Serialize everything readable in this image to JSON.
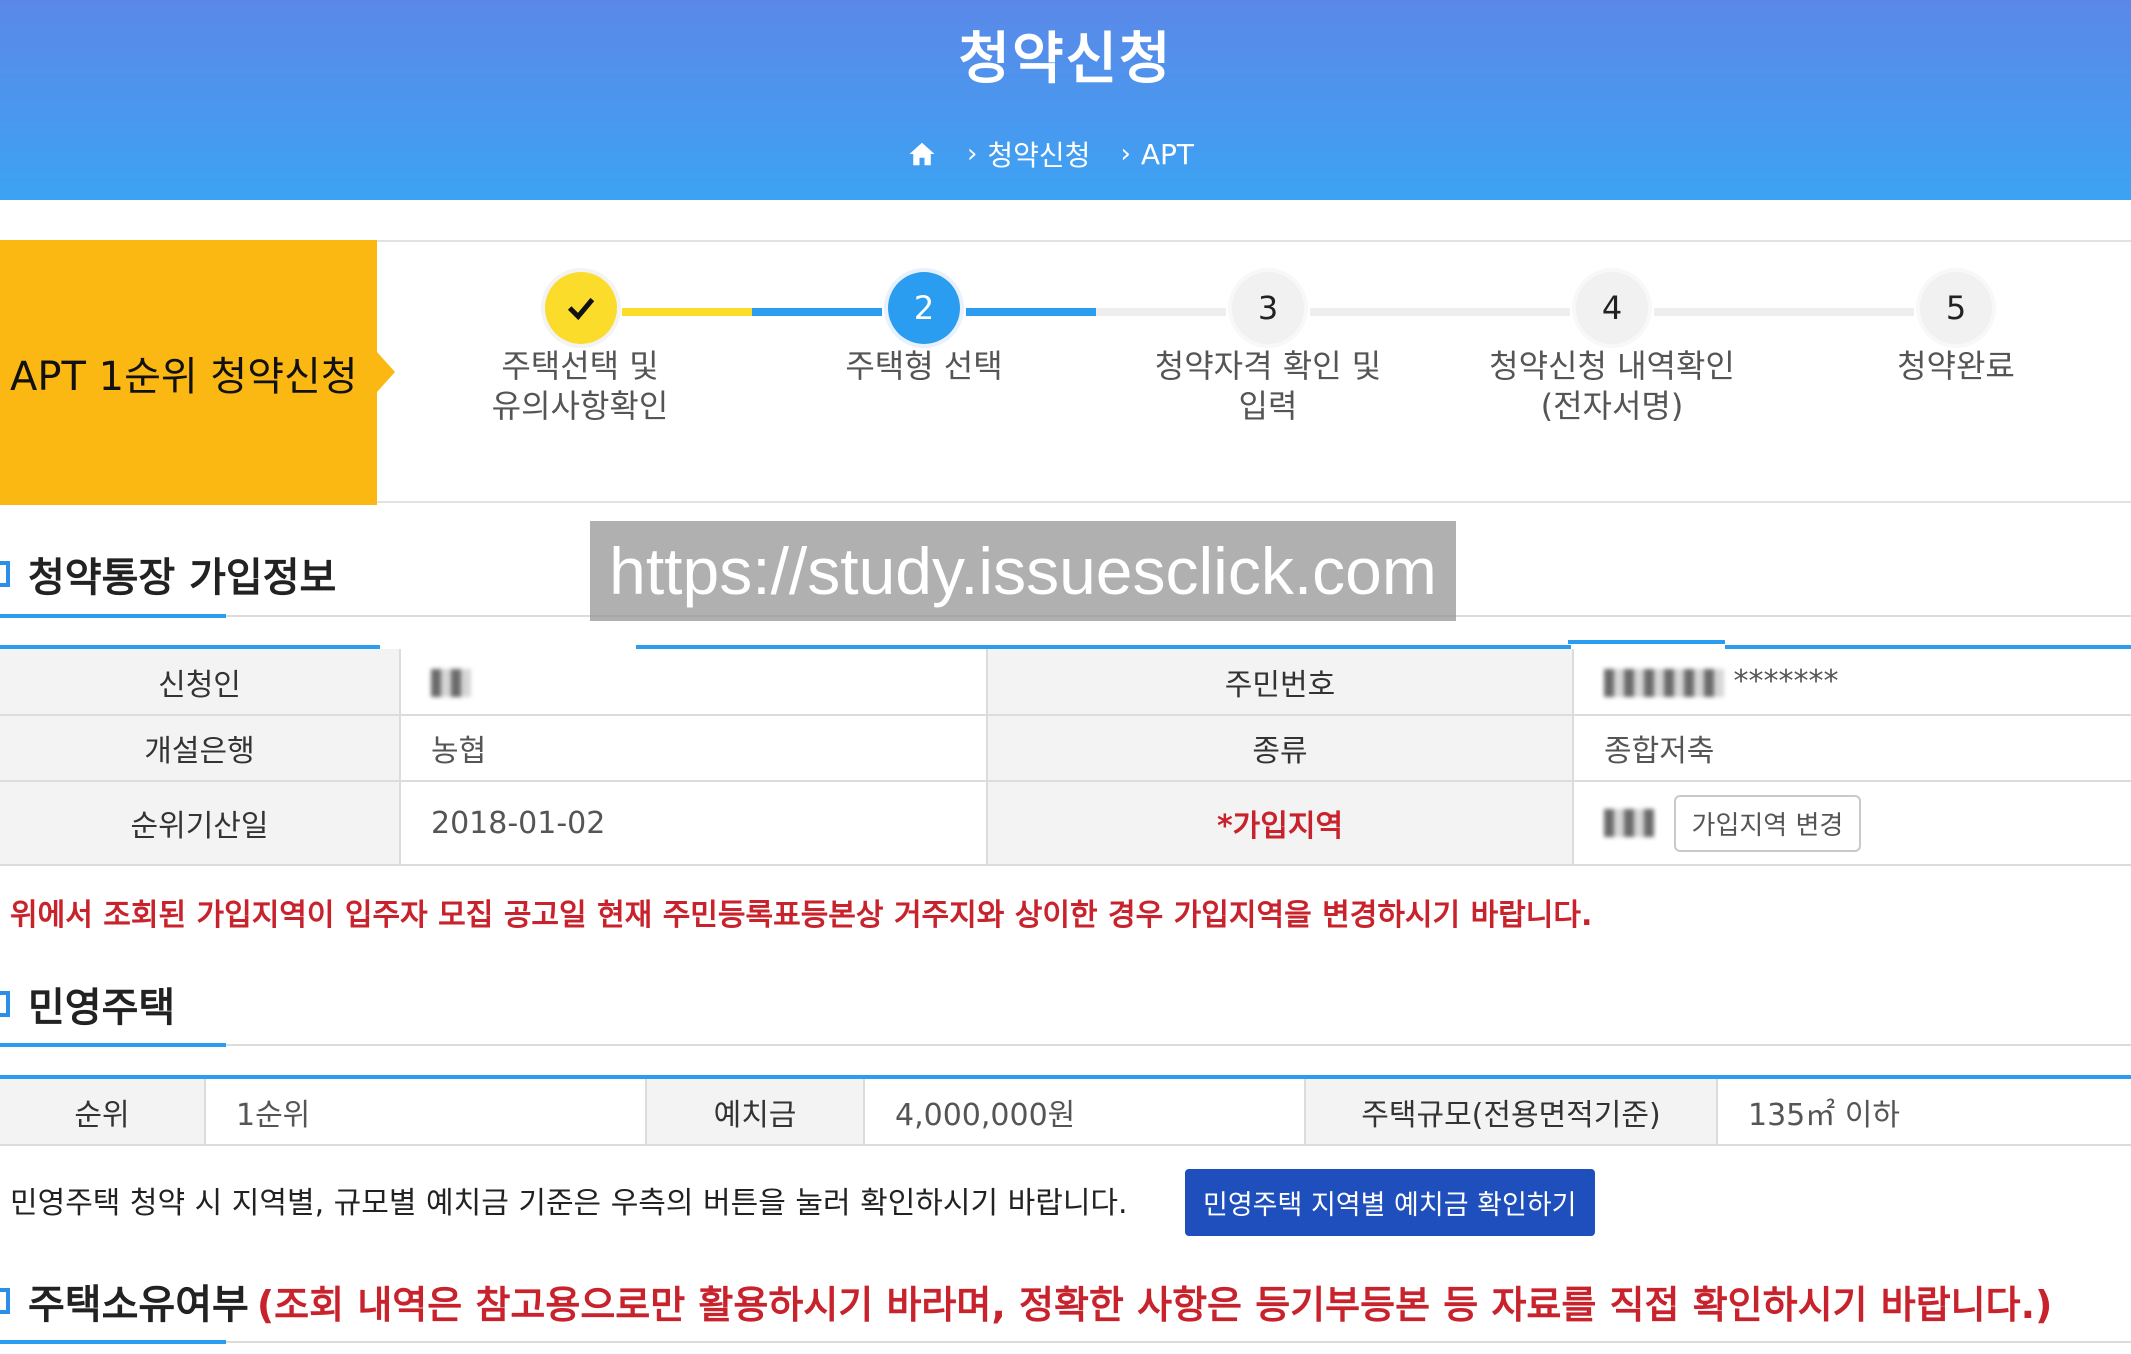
{
  "header": {
    "title": "청약신청",
    "breadcrumb": [
      "청약신청",
      "APT"
    ]
  },
  "steps": {
    "label": "APT 1순위 청약신청",
    "items": [
      {
        "number": "✓",
        "line1": "주택선택 및",
        "line2": "유의사항확인",
        "state": "done"
      },
      {
        "number": "2",
        "line1": "주택형 선택",
        "line2": "",
        "state": "current"
      },
      {
        "number": "3",
        "line1": "청약자격 확인 및",
        "line2": "입력",
        "state": "todo"
      },
      {
        "number": "4",
        "line1": "청약신청 내역확인",
        "line2": "(전자서명)",
        "state": "todo"
      },
      {
        "number": "5",
        "line1": "청약완료",
        "line2": "",
        "state": "todo"
      }
    ]
  },
  "watermark": "https://study.issuesclick.com",
  "account": {
    "title": "청약통장 가입정보",
    "applicant_label": "신청인",
    "rrn_label": "주민번호",
    "rrn_suffix": "*******",
    "bank_label": "개설은행",
    "bank_value": "농협",
    "type_label": "종류",
    "type_value": "종합저축",
    "date_label": "순위기산일",
    "date_value": "2018-01-02",
    "region_label": "*가입지역",
    "region_button": "가입지역 변경",
    "notice": "위에서 조회된 가입지역이 입주자 모집 공고일 현재 주민등록표등본상 거주지와 상이한 경우 가입지역을 변경하시기 바랍니다."
  },
  "private": {
    "title": "민영주택",
    "rank_label": "순위",
    "rank_value": "1순위",
    "deposit_label": "예치금",
    "deposit_value": "4,000,000원",
    "size_label": "주택규모(전용면적기준)",
    "size_value": "135㎡ 이하",
    "notice": "민영주택 청약 시 지역별, 규모별 예치금 기준은 우측의 버튼을 눌러 확인하시기 바랍니다.",
    "check_button": "민영주택 지역별 예치금 확인하기"
  },
  "ownership": {
    "title": "주택소유여부",
    "note": "(조회 내역은 참고용으로만 활용하시기 바라며, 정확한 사항은 등기부등본 등 자료를 직접 확인하시기 바랍니다.)"
  },
  "colors": {
    "header_top": "#5b88e8",
    "header_bottom": "#3ca3f3",
    "step_label_bg": "#fbb813",
    "done": "#fbdc2b",
    "current": "#2b9df1",
    "accent": "#2b9df1",
    "warning": "#c8232c",
    "button": "#1e4fbd"
  }
}
